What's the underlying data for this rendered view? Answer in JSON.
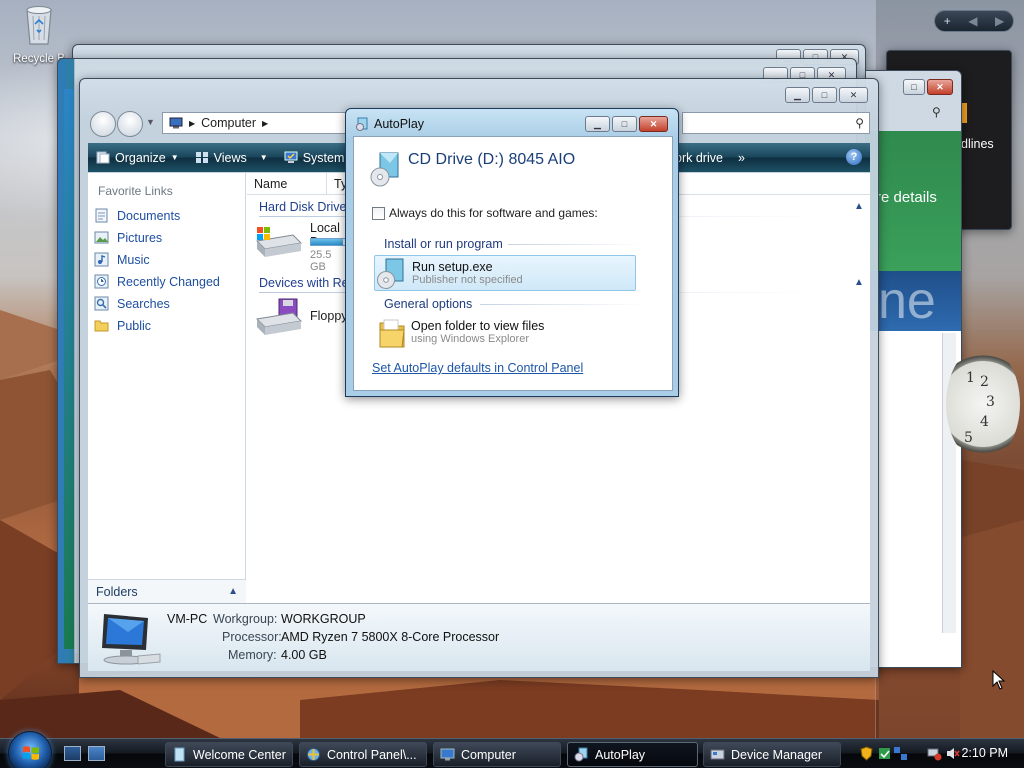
{
  "desktop": {
    "recycle_bin_label": "Recycle B"
  },
  "gadgets": {
    "sidebar_controls": [
      "+",
      "◀",
      "▶"
    ],
    "headlines_text": "dlines",
    "details_text": "re details",
    "ne_text": "ne",
    "clock_numbers": [
      "1",
      "2",
      "3",
      "4",
      "5"
    ]
  },
  "explorer": {
    "address_text": "Computer",
    "toolbar": {
      "organize": "Organize",
      "views": "Views",
      "system_props": "System p",
      "map_drive": "ork drive",
      "more": "»",
      "help": "?"
    },
    "favorite_links_header": "Favorite Links",
    "favorites": [
      {
        "label": "Documents",
        "icon": "documents-icon"
      },
      {
        "label": "Pictures",
        "icon": "pictures-icon"
      },
      {
        "label": "Music",
        "icon": "music-icon"
      },
      {
        "label": "Recently Changed",
        "icon": "recent-icon"
      },
      {
        "label": "Searches",
        "icon": "searches-icon"
      },
      {
        "label": "Public",
        "icon": "public-folder-icon"
      }
    ],
    "folders_label": "Folders",
    "columns": [
      "Name",
      "Ty"
    ],
    "groups": {
      "hard_disk": "Hard Disk Drives",
      "removable": "Devices with Rer"
    },
    "items": {
      "local_disk_name": "Local D",
      "local_disk_free": "25.5 GB",
      "local_disk_fill": 0.85,
      "floppy_name": "Floppy"
    },
    "details": {
      "computer_name": "VM-PC",
      "workgroup_label": "Workgroup:",
      "workgroup_value": "WORKGROUP",
      "processor_label": "Processor:",
      "processor_value": "AMD Ryzen 7 5800X 8-Core Processor",
      "memory_label": "Memory:",
      "memory_value": "4.00 GB"
    }
  },
  "autoplay": {
    "title": "AutoPlay",
    "drive_heading": "CD Drive (D:) 8045 AIO",
    "always_checkbox_label": "Always do this for software and games:",
    "always_checked": false,
    "section_install": "Install or run program",
    "run_title": "Run setup.exe",
    "run_sub": "Publisher not specified",
    "section_general": "General options",
    "open_title": "Open folder to view files",
    "open_sub": "using Windows Explorer",
    "defaults_link": "Set AutoPlay defaults in Control Panel"
  },
  "taskbar": {
    "tasks": [
      {
        "label": "Welcome Center",
        "icon": "welcome-center-icon",
        "active": false
      },
      {
        "label": "Control Panel\\...",
        "icon": "control-panel-icon",
        "active": false
      },
      {
        "label": "Computer",
        "icon": "computer-icon",
        "active": false
      },
      {
        "label": "AutoPlay",
        "icon": "autoplay-icon",
        "active": true
      },
      {
        "label": "Device Manager",
        "icon": "device-manager-icon",
        "active": false
      }
    ],
    "clock": "2:10 PM"
  },
  "colors": {
    "accent_link": "#1e4fa0",
    "toolbar_dark": "#194459",
    "taskbar_dark": "#151a21",
    "close_red": "#c4402b"
  }
}
